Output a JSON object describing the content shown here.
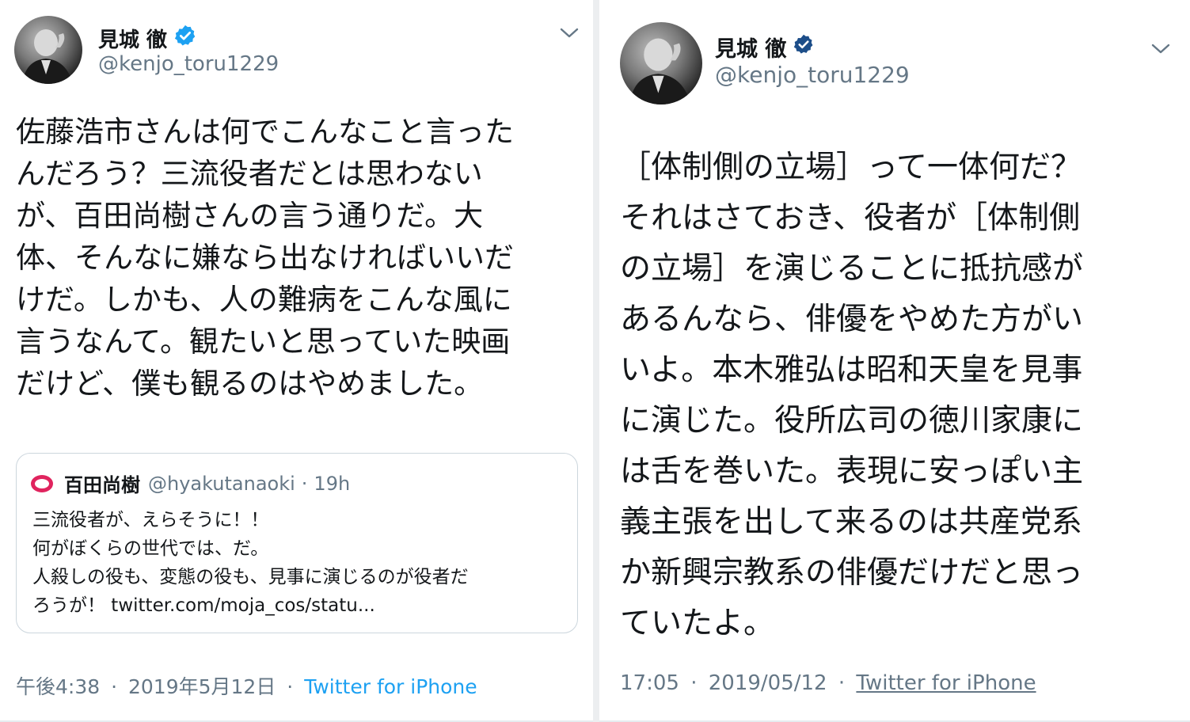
{
  "tweet_left": {
    "name": "見城 徹",
    "handle": "@kenjo_toru1229",
    "body": "佐藤浩市さんは何でこんなこと言った\nんだろう？三流役者だとは思わない\nが、百田尚樹さんの言う通りだ。大\n体、そんなに嫌なら出なければいいだ\nけだ。しかも、人の難病をこんな風に\n言うなんて。観たいと思っていた映画\nだけど、僕も観るのはやめました。",
    "quote": {
      "name": "百田尚樹",
      "handle": "@hyakutanaoki",
      "separator": "·",
      "time": "19h",
      "body": "三流役者が、えらそうに！！\n何がぼくらの世代では、だ。\n人殺しの役も、変態の役も、見事に演じるのが役者だ\nろうが！ twitter.com/moja_cos/statu..."
    },
    "time": "午後4:38",
    "date": "2019年5月12日",
    "separator": "·",
    "source": "Twitter for iPhone"
  },
  "tweet_right": {
    "name": "見城 徹",
    "handle": "@kenjo_toru1229",
    "body": "［体制側の立場］って一体何だ？\nそれはさておき、役者が［体制側\nの立場］を演じることに抵抗感が\nあるんなら、俳優をやめた方がい\nいよ。本木雅弘は昭和天皇を見事\nに演じた。役所広司の徳川家康に\nは舌を巻いた。表現に安っぽい主\n義主張を出して来るのは共産党系\nか新興宗教系の俳優だけだと思っ\nていたよ。",
    "time": "17:05",
    "date": "2019/05/12",
    "separator": "·",
    "source": "Twitter for iPhone"
  },
  "colors": {
    "text": "#14171a",
    "secondary": "#657786",
    "link": "#1da1f2",
    "verified_left": "#1da1f2",
    "verified_right": "#1d4e89",
    "quote_avatar_ring": "#e0245e",
    "border": "#ccd6dd"
  },
  "icons": [
    "verified-badge-icon",
    "chevron-down-icon",
    "avatar"
  ]
}
